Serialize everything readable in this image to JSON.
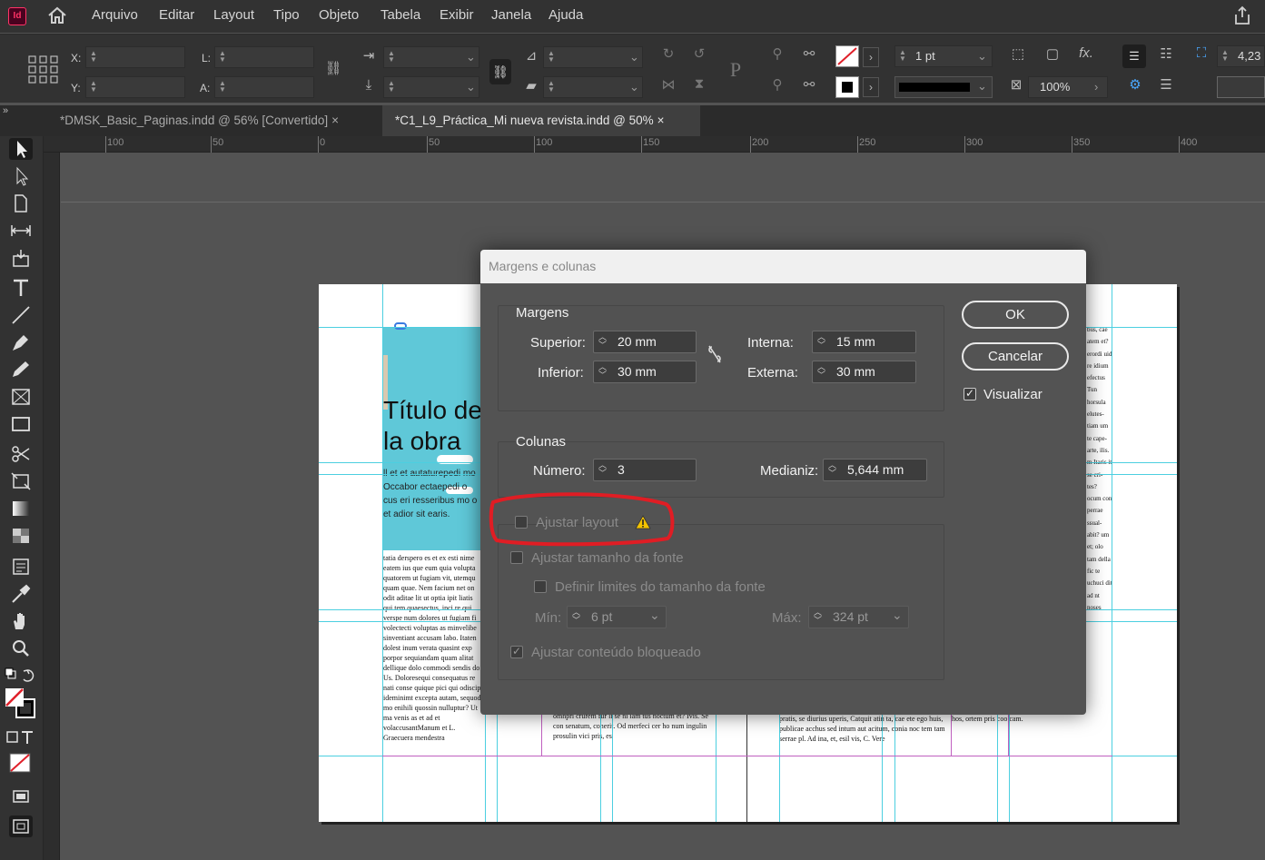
{
  "menubar": {
    "app_icon_label": "Id",
    "items": [
      "Arquivo",
      "Editar",
      "Layout",
      "Tipo",
      "Objeto",
      "Tabela",
      "Exibir",
      "Janela",
      "Ajuda"
    ]
  },
  "control_bar": {
    "x_label": "X:",
    "y_label": "Y:",
    "w_label": "L:",
    "h_label": "A:",
    "stroke_weight": "1 pt",
    "zoom_percent": "100%",
    "partial_value": "4,23"
  },
  "tabs": [
    {
      "label": "*DMSK_Basic_Paginas.indd @ 56% [Convertido]",
      "close": "×"
    },
    {
      "label": "*C1_L9_Práctica_Mi nueva revista.indd @ 50%",
      "close": "×"
    }
  ],
  "ruler": {
    "top_labels": [
      "100",
      "50",
      "0",
      "50",
      "100",
      "150",
      "200",
      "250",
      "300",
      "350",
      "400"
    ]
  },
  "page_content": {
    "title_line1": "Título de",
    "title_line2": "la obra",
    "lead_text": "ll et et autaturepedi mo Occabor ectaepedi o cus eri resseribus mo o et adior sit earis.",
    "body_left": "tatia derspero es et ex esti nime eatem ius que eum quia volupta quatorem ut fugiam vit, utemqu quam quae. Nem facium net on odit aditae lit ut optia ipit liatis qui tem quaesectus, inci re qui verspe num dolores ut fugiam fi volectecti voluptas as minvelibe sinventiant accusam labo. Itaten dolest inum verata quasint exp porpor sequiandam quam alitat dellique dolo commodi sendis do Us. Doloresequi consequatus re nati conse quique pici qui odiscip ideminimt excepta autam, sequod mo enihili quossin nulluptur? Ut ma venis as et ad et volaccusantManum et L. Graecuera mendestra",
    "body_mid": "omnpri crurem fur li se ni iam tus noctum et? Ivis. Se con senatum, conerit. Od merfeci cer ho num ingulin prosulin vici pris, es",
    "body_right_bottom": "pratis, se diurius uperis, Catquit atin ta, cae ete ego huis, publicae acchus sed intum aut acitum, conia noc tem tam serrae pl. Ad ina, et, esil vis, C. Vere",
    "body_far_right": "hos, ortem pris coo cam.",
    "right_column": "bus, cae atem et? erordi uid re idium efectus Tun horsula elutes- tiam um te cape- arte, ilis. m Itaris it se cri- tes? ocum con perrae ssual- abit? um et; olo tam della fic te uchuci dit ad nt noses"
  },
  "dialog": {
    "title": "Margens e colunas",
    "margins": {
      "heading": "Margens",
      "top_label": "Superior:",
      "top_value": "20 mm",
      "bottom_label": "Inferior:",
      "bottom_value": "30 mm",
      "inside_label": "Interna:",
      "inside_value": "15 mm",
      "outside_label": "Externa:",
      "outside_value": "30 mm"
    },
    "columns": {
      "heading": "Colunas",
      "number_label": "Número:",
      "number_value": "3",
      "gutter_label": "Medianiz:",
      "gutter_value": "5,644 mm"
    },
    "adjust": {
      "adjust_layout": "Ajustar layout",
      "adjust_font_size": "Ajustar tamanho da fonte",
      "set_font_limits": "Definir limites do tamanho da fonte",
      "min_label": "Mín:",
      "min_value": "6 pt",
      "max_label": "Máx:",
      "max_value": "324 pt",
      "adjust_locked": "Ajustar conteúdo bloqueado"
    },
    "ok": "OK",
    "cancel": "Cancelar",
    "preview": "Visualizar",
    "highlight_color": "#e01d24"
  }
}
